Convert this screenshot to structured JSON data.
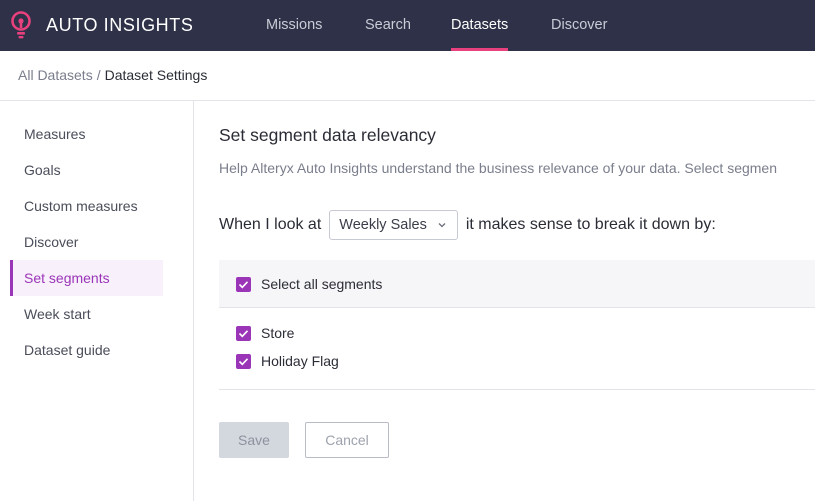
{
  "app": {
    "name": "AUTO INSIGHTS",
    "brand_color": "#e8417d"
  },
  "nav": {
    "tabs": [
      {
        "label": "Missions",
        "active": false
      },
      {
        "label": "Search",
        "active": false
      },
      {
        "label": "Datasets",
        "active": true
      },
      {
        "label": "Discover",
        "active": false
      }
    ]
  },
  "breadcrumb": {
    "parent": "All Datasets",
    "separator": "/",
    "current": "Dataset Settings"
  },
  "sidebar": {
    "items": [
      {
        "label": "Measures",
        "active": false
      },
      {
        "label": "Goals",
        "active": false
      },
      {
        "label": "Custom measures",
        "active": false
      },
      {
        "label": "Discover",
        "active": false
      },
      {
        "label": "Set segments",
        "active": true
      },
      {
        "label": "Week start",
        "active": false
      },
      {
        "label": "Dataset guide",
        "active": false
      }
    ]
  },
  "main": {
    "title": "Set segment data relevancy",
    "description": "Help Alteryx Auto Insights understand the business relevance of your data. Select segmen",
    "look_prefix": "When I look at",
    "measure_select": {
      "value": "Weekly Sales"
    },
    "look_suffix": "it makes sense to break it down by:",
    "select_all": {
      "label": "Select all segments",
      "checked": true
    },
    "segments": [
      {
        "label": "Store",
        "checked": true
      },
      {
        "label": "Holiday Flag",
        "checked": true
      }
    ],
    "save_label": "Save",
    "cancel_label": "Cancel"
  },
  "colors": {
    "accent": "#9b35b8",
    "topbar": "#2e3147"
  },
  "icons": {
    "brand": "lightbulb-icon",
    "checkbox": "check-icon",
    "select": "chevron-down-icon"
  }
}
